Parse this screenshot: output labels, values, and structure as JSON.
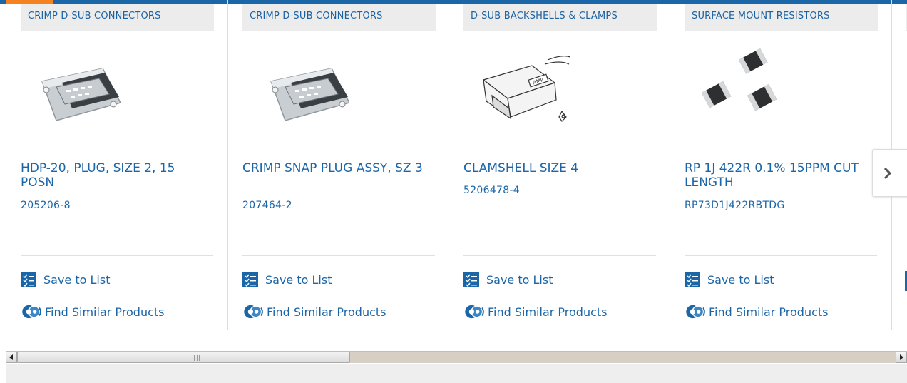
{
  "colors": {
    "brand_blue": "#1a66a6",
    "link_blue": "#1c66a8",
    "accent_orange": "#f5821f",
    "category_bg": "#ececec"
  },
  "products": [
    {
      "category": "CRIMP D-SUB CONNECTORS",
      "title": "HDP-20, PLUG, SIZE 2, 15 POSN",
      "part_number": "205206-8",
      "image": "dsub-connector-photo"
    },
    {
      "category": "CRIMP D-SUB CONNECTORS",
      "title": "CRIMP SNAP PLUG ASSY, SZ 3",
      "part_number": "207464-2",
      "image": "dsub-connector-photo"
    },
    {
      "category": "D-SUB BACKSHELLS & CLAMPS",
      "title": "CLAMSHELL SIZE 4",
      "part_number": "5206478-4",
      "image": "backshell-drawing"
    },
    {
      "category": "SURFACE MOUNT RESISTORS",
      "title": "RP 1J 422R 0.1% 15PPM CUT LENGTH",
      "part_number": "RP73D1J422RBTDG",
      "image": "smd-resistor-photo"
    }
  ],
  "actions": {
    "save_label": "Save to List",
    "similar_label": "Find Similar Products"
  },
  "icons": {
    "save": "checklist-icon",
    "similar": "similar-products-icon",
    "next": "chevron-right-icon"
  }
}
